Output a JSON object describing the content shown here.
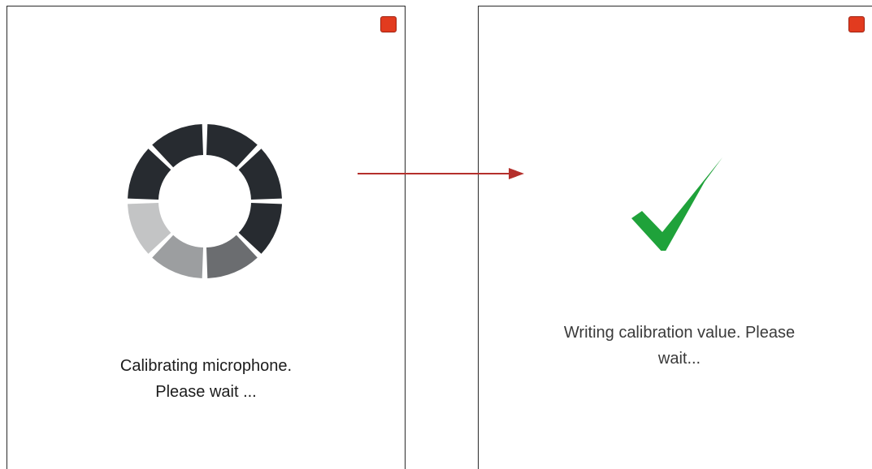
{
  "screens": [
    {
      "status_icon": "loading-spinner-icon",
      "message_line1": "Calibrating microphone.",
      "message_line2": "Please wait ...",
      "close_icon": "stop-square-icon"
    },
    {
      "status_icon": "checkmark-icon",
      "message_line1": "Writing calibration value. Please",
      "message_line2": "wait...",
      "close_icon": "stop-square-icon"
    }
  ],
  "flow_arrow_icon": "arrow-right-icon",
  "colors": {
    "stop_button": "#e23b1f",
    "stop_button_border": "#9e2110",
    "spinner_dark": "#272b30",
    "spinner_mid": "#6b6d70",
    "spinner_light": "#9c9ea0",
    "spinner_lighter": "#c3c4c5",
    "checkmark": "#1fa23a",
    "arrow": "#b5302c"
  },
  "spinner_segments": [
    "dark",
    "dark",
    "dark",
    "mid",
    "light",
    "lighter",
    "dark",
    "dark"
  ]
}
